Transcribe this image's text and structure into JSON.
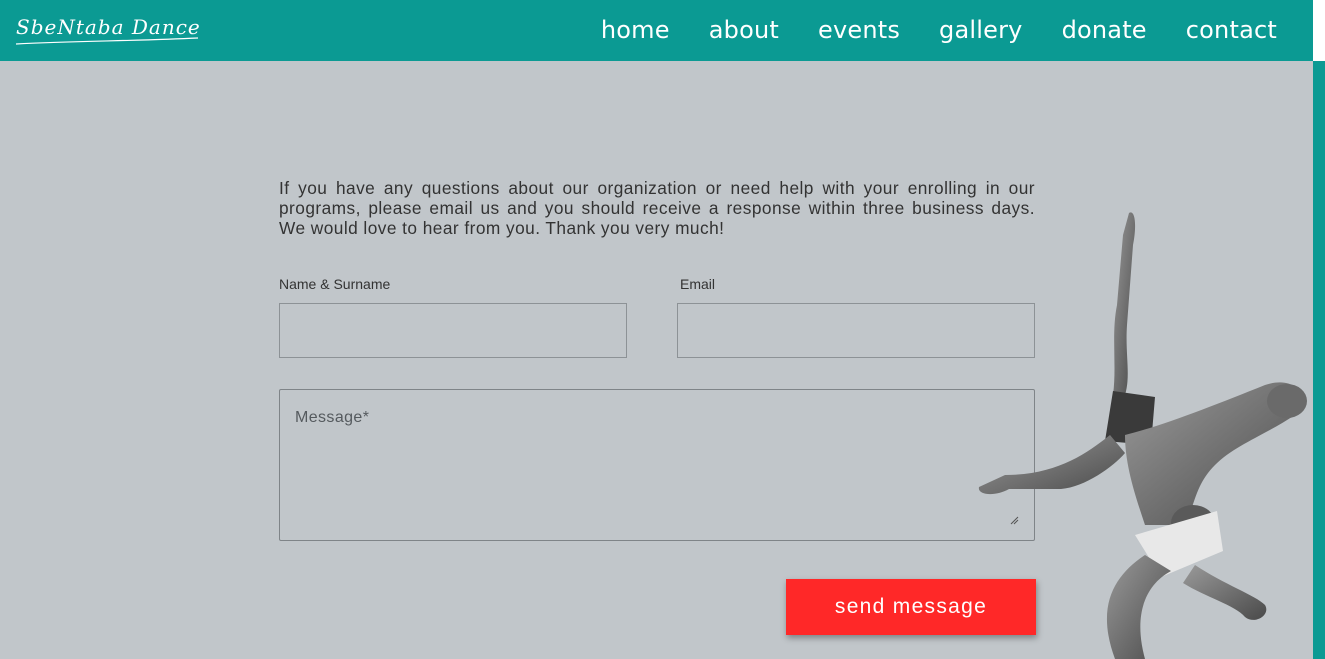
{
  "header": {
    "logo_text": "SbeNtaba Dance",
    "nav": [
      "home",
      "about",
      "events",
      "gallery",
      "donate",
      "contact"
    ]
  },
  "contact": {
    "intro": "If you have any questions about our organization or need help with your enrolling in our programs, please email us and you should receive a response within three business days. We would love to hear from you. Thank you very much!",
    "name_label": "Name & Surname",
    "email_label": "Email",
    "name_value": "",
    "email_value": "",
    "message_placeholder": "Message*",
    "send_label": "send message"
  },
  "colors": {
    "brand": "#0b9a93",
    "background": "#c1c6ca",
    "send_button": "#ff2828"
  },
  "image": {
    "icon": "dancers-photo"
  }
}
